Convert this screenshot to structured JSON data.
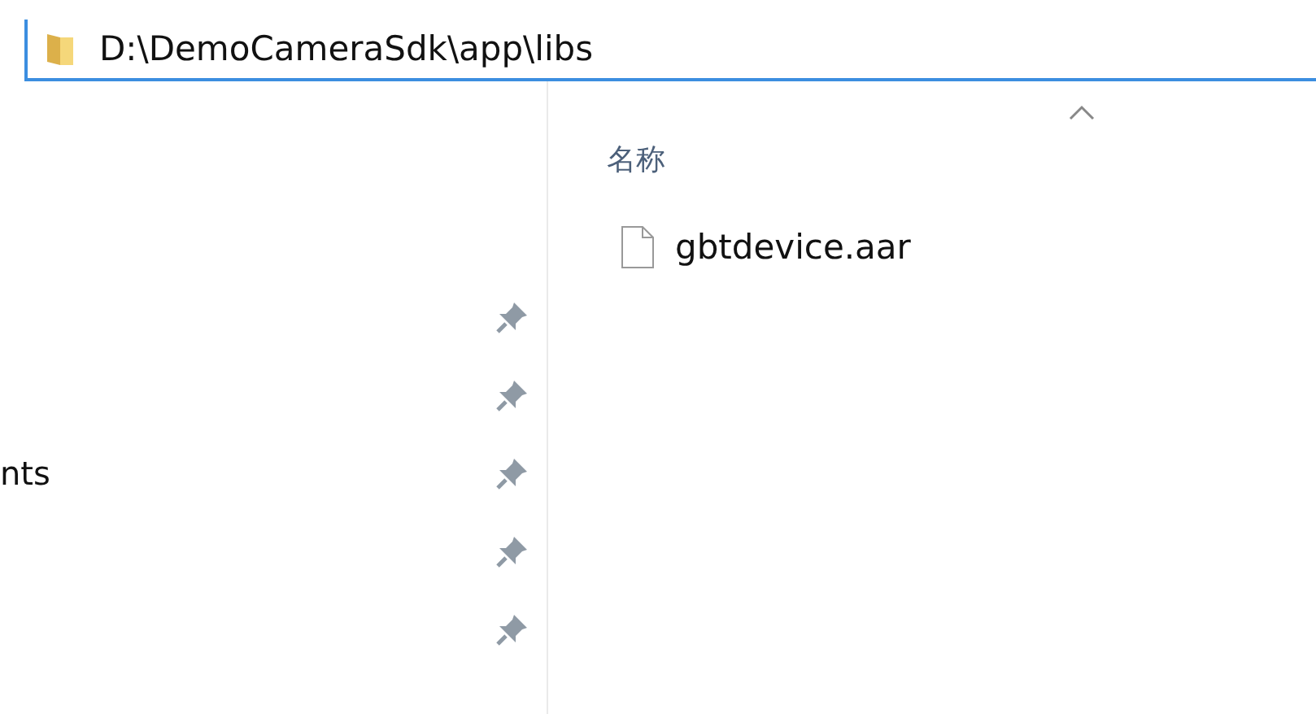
{
  "address_bar": {
    "path": "D:\\DemoCameraSdk\\app\\libs"
  },
  "navigation_pane": {
    "items": [
      {
        "pinned": true
      },
      {
        "pinned": true
      },
      {
        "label": "nts",
        "pinned": true
      },
      {
        "pinned": true
      },
      {
        "pinned": true
      }
    ]
  },
  "file_list": {
    "columns": [
      {
        "label": "名称",
        "sorted": true
      }
    ],
    "files": [
      {
        "name": "gbtdevice.aar"
      }
    ]
  }
}
